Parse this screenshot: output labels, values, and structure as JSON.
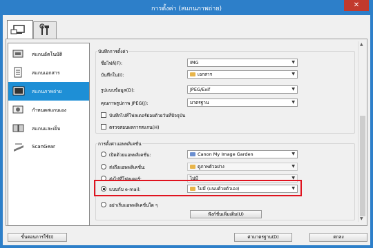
{
  "window": {
    "title": "การตั้งค่า (สแกนภาพถ่าย)",
    "close_glyph": "✕"
  },
  "tabs": [
    {
      "icon": "scanner-computer-icon"
    },
    {
      "icon": "tools-icon"
    }
  ],
  "nav": {
    "items": [
      {
        "label": "สแกนอัตโนมัติ",
        "icon": "auto-scan-icon",
        "selected": false
      },
      {
        "label": "สแกนเอกสาร",
        "icon": "document-scan-icon",
        "selected": false
      },
      {
        "label": "สแกนภาพถ่าย",
        "icon": "photo-scan-icon",
        "selected": true
      },
      {
        "label": "กำหนดสแกนเอง",
        "icon": "custom-scan-icon",
        "selected": false
      },
      {
        "label": "สแกนและเย็บ",
        "icon": "scan-stitch-icon",
        "selected": false
      },
      {
        "label": "ScanGear",
        "icon": "scangear-icon",
        "selected": false
      }
    ]
  },
  "save": {
    "group_label": "บันทึกการตั้งค่า",
    "filename_label": "ชื่อไฟล์(F):",
    "filename_value": "IMG",
    "savein_label": "บันทึกใน(I):",
    "savein_value": "เอกสาร",
    "format_label": "รูปแบบข้อมูล(D):",
    "format_value": "JPEG/Exif",
    "jpeg_label": "คุณภาพรูปภาพ JPEG(J):",
    "jpeg_value": "มาตรฐาน",
    "subfolder_label": "บันทึกไปที่โฟลเดอร์ย่อยด้วยวันที่ปัจจุบัน",
    "check_label": "ตรวจสอบผลการสแกน(H)"
  },
  "app": {
    "group_label": "การตั้งค่าแอพพลิเคชั่น",
    "open_label": "เปิดด้วยแอพพลิเคชั่น:",
    "open_value": "Canon My Image Garden",
    "send_app_label": "ส่งถึงแอพพลิเคชั่น:",
    "send_app_value": "ดูภาพตัวอย่าง",
    "send_folder_label": "ส่งไปที่โฟลเดอร์:",
    "send_folder_value": "ไม่มี",
    "email_label": "แนบกับ e-mail:",
    "email_value": "ไม่มี (แนบด้วยตัวเอง)",
    "other_label": "อย่าเริ่มแอพพลิเคชั่นใด ๆ",
    "more_button": "ฟังก์ชั่นเพิ่มเติม(U)"
  },
  "footer": {
    "instructions": "ขั้นตอนการใช้(I)",
    "defaults": "ค่ามาตรฐาน(D)",
    "ok": "ตกลง"
  }
}
